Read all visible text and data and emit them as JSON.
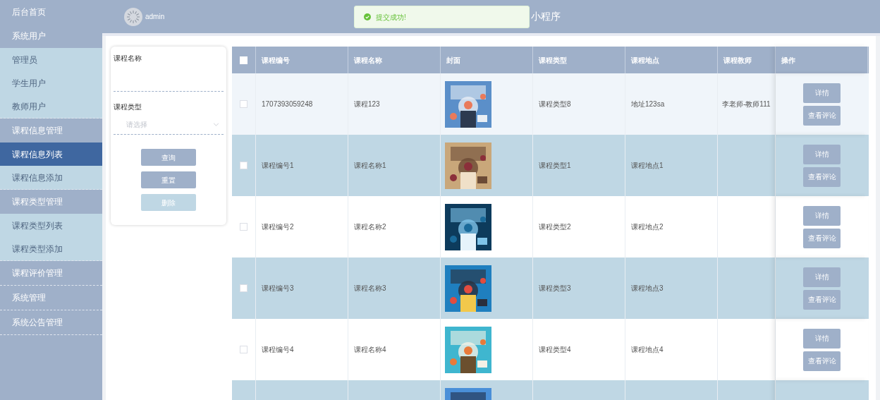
{
  "sidebar": {
    "menu": [
      {
        "label": "后台首页"
      },
      {
        "label": "系统用户",
        "children": [
          {
            "label": "管理员",
            "selected": false
          },
          {
            "label": "学生用户",
            "selected": false
          },
          {
            "label": "教师用户",
            "selected": false
          }
        ]
      },
      {
        "label": "课程信息管理",
        "children": [
          {
            "label": "课程信息列表",
            "selected": true
          },
          {
            "label": "课程信息添加",
            "selected": false
          }
        ]
      },
      {
        "label": "课程类型管理",
        "children": [
          {
            "label": "课程类型列表",
            "selected": false
          },
          {
            "label": "课程类型添加",
            "selected": false
          }
        ]
      },
      {
        "label": "课程评价管理"
      },
      {
        "label": "系统管理"
      },
      {
        "label": "系统公告管理"
      }
    ]
  },
  "header": {
    "user": "admin",
    "title": "小程序"
  },
  "toast": {
    "message": "提交成功!"
  },
  "search": {
    "fields": [
      {
        "label": "课程名称",
        "kind": "input"
      },
      {
        "label": "课程类型",
        "kind": "select",
        "placeholder": "请选择"
      }
    ],
    "buttons": [
      {
        "label": "查询",
        "disabled": false
      },
      {
        "label": "重置",
        "disabled": false
      },
      {
        "label": "删除",
        "disabled": true
      }
    ]
  },
  "table": {
    "columns": [
      "课程编号",
      "课程名称",
      "封面",
      "课程类型",
      "课程地点",
      "课程教师",
      "操作"
    ],
    "header_checked": false,
    "rows": [
      {
        "hovered": true,
        "checked": false,
        "cells": [
          "1707393059248",
          "课程123"
        ],
        "cover": {
          "kind": "picture"
        },
        "type": "课程类型8",
        "place": "地址123sa",
        "teacher": "李老师-教师111",
        "actions": [
          "详情",
          "查看评论"
        ]
      },
      {
        "hovered": false,
        "checked": false,
        "cells": [
          "课程编号1",
          "课程名称1"
        ],
        "cover": {
          "kind": "picture"
        },
        "type": "课程类型1",
        "place": "课程地点1",
        "actions": [
          "详情",
          "查看评论"
        ]
      },
      {
        "hovered": false,
        "checked": false,
        "cells": [
          "课程编号2",
          "课程名称2"
        ],
        "cover": {
          "kind": "picture"
        },
        "type": "课程类型2",
        "place": "课程地点2",
        "actions": [
          "详情",
          "查看评论"
        ]
      },
      {
        "hovered": false,
        "checked": false,
        "cells": [
          "课程编号3",
          "课程名称3"
        ],
        "cover": {
          "kind": "picture"
        },
        "type": "课程类型3",
        "place": "课程地点3",
        "actions": [
          "详情",
          "查看评论"
        ]
      },
      {
        "hovered": false,
        "checked": false,
        "cells": [
          "课程编号4",
          "课程名称4"
        ],
        "cover": {
          "kind": "picture"
        },
        "type": "课程类型4",
        "place": "课程地点4",
        "actions": [
          "详情",
          "查看评论"
        ]
      },
      {
        "hovered": false,
        "cover": {
          "kind": "picture"
        }
      }
    ]
  }
}
